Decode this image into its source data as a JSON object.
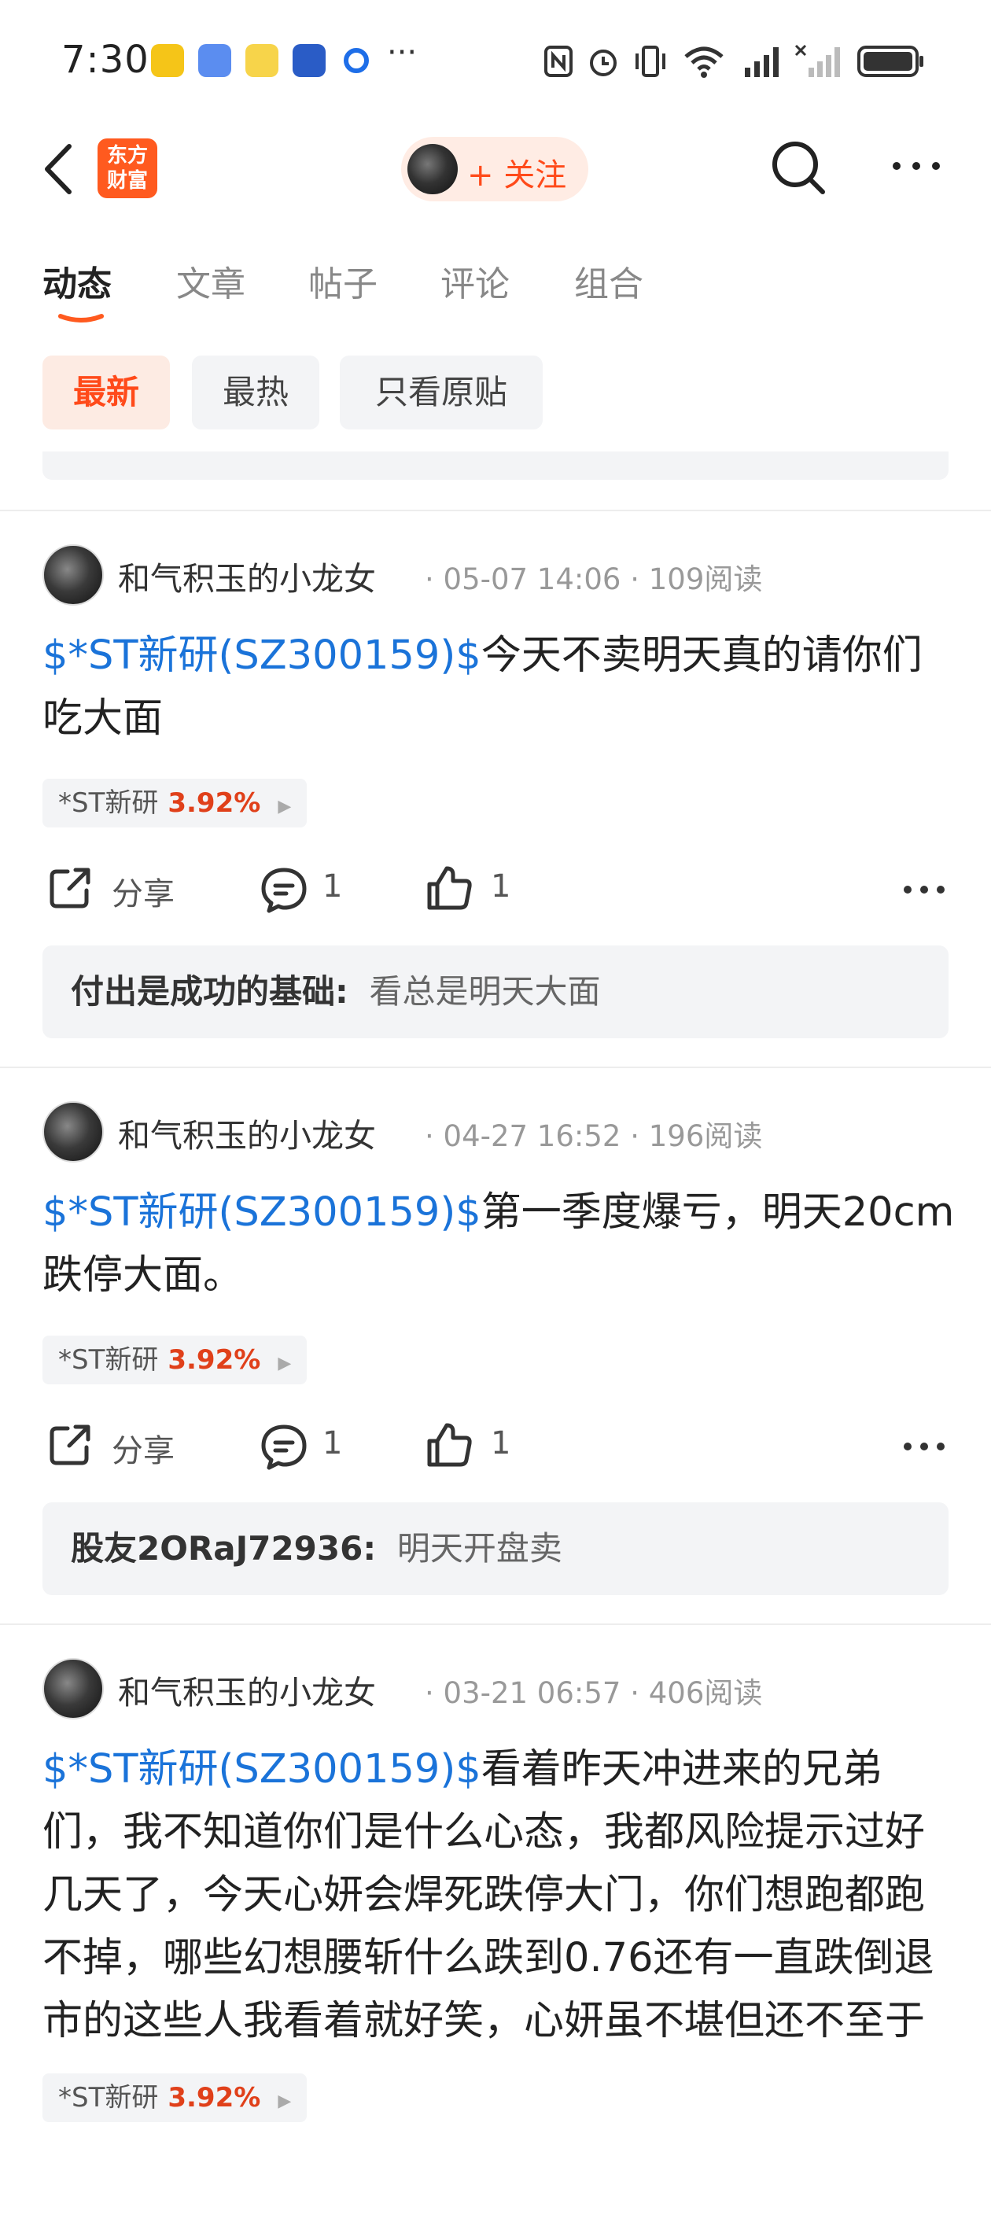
{
  "status_bar": {
    "time": "7:30",
    "more": "···"
  },
  "header": {
    "logo_text": "东方财富",
    "follow_label": "+ 关注"
  },
  "tabs": [
    "动态",
    "文章",
    "帖子",
    "评论",
    "组合"
  ],
  "filters": [
    "最新",
    "最热",
    "只看原贴"
  ],
  "posts": [
    {
      "author": "和气积玉的小龙女",
      "date": "05-07 14:06",
      "reads": "109阅读",
      "tag": "$*ST新研(SZ300159)$",
      "text": "今天不卖明天真的请你们吃大面",
      "stock_name": "*ST新研",
      "stock_pct": "3.92%",
      "share_label": "分享",
      "comments": "1",
      "likes": "1",
      "comment_author": "付出是成功的基础",
      "comment_sep": ":",
      "comment_text": "看总是明天大面"
    },
    {
      "author": "和气积玉的小龙女",
      "date": "04-27 16:52",
      "reads": "196阅读",
      "tag": "$*ST新研(SZ300159)$",
      "text": "第一季度爆亏，明天20cm跌停大面。",
      "stock_name": "*ST新研",
      "stock_pct": "3.92%",
      "share_label": "分享",
      "comments": "1",
      "likes": "1",
      "comment_author": "股友2ORaJ72936",
      "comment_sep": ":",
      "comment_text": "明天开盘卖"
    },
    {
      "author": "和气积玉的小龙女",
      "date": "03-21 06:57",
      "reads": "406阅读",
      "tag": "$*ST新研(SZ300159)$",
      "text": "看着昨天冲进来的兄弟们，我不知道你们是什么心态，我都风险提示过好几天了，今天心妍会焊死跌停大门，你们想跑都跑不掉，哪些幻想腰斩什么跌到0.76还有一直跌倒退市的这些人我看着就好笑，心妍虽不堪但还不至于这么下作。下个礼拜一就…",
      "stock_name": "*ST新研",
      "stock_pct": "3.92%"
    }
  ],
  "colors": {
    "accent": "#ff4a1a",
    "link": "#1a73d9",
    "positive": "#e0401a"
  }
}
